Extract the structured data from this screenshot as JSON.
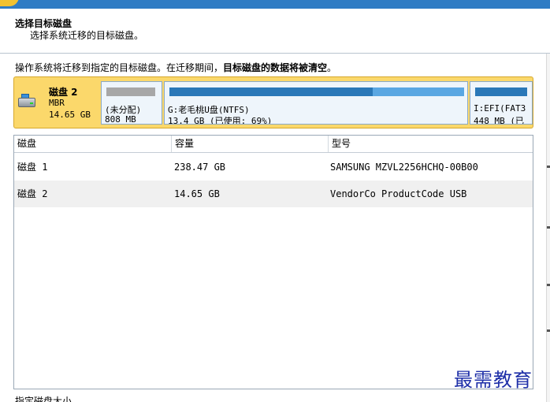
{
  "header": {
    "title": "选择目标磁盘",
    "subtitle": "选择系统迁移的目标磁盘。"
  },
  "notice": {
    "text": "操作系统将迁移到指定的目标磁盘。在迁移期间，",
    "warning": "目标磁盘的数据将被清空",
    "end": "。"
  },
  "disk_map": {
    "name": "磁盘 2",
    "partition_style": "MBR",
    "size": "14.65 GB",
    "partitions": [
      {
        "label": "(未分配)",
        "size": "808 MB"
      },
      {
        "label": "G:老毛桃U盘(NTFS)",
        "size": "13.4 GB (已使用: 69%)",
        "used_fraction": 0.69
      },
      {
        "label": "I:EFI(FAT3",
        "size": "448 MB (已"
      }
    ]
  },
  "table": {
    "columns": [
      "磁盘",
      "容量",
      "型号"
    ],
    "rows": [
      {
        "disk": "磁盘 1",
        "capacity": "238.47 GB",
        "model": "SAMSUNG MZVL2256HCHQ-00B00"
      },
      {
        "disk": "磁盘 2",
        "capacity": "14.65 GB",
        "model": "VendorCo ProductCode USB"
      }
    ]
  },
  "watermark": "最需教育",
  "footer": "指定磁盘大小。"
}
